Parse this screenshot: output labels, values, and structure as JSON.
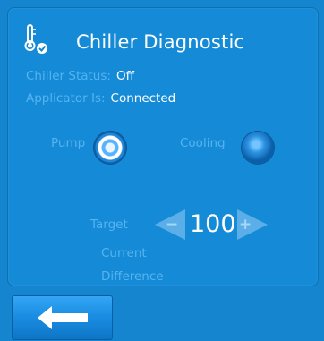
{
  "header": {
    "title": "Chiller Diagnostic",
    "icon": "thermometer-check-icon"
  },
  "status": {
    "chiller_label": "Chiller Status:",
    "chiller_value": "Off",
    "applicator_label": "Applicator Is:",
    "applicator_value": "Connected"
  },
  "controls": {
    "pump_label": "Pump",
    "cooling_label": "Cooling"
  },
  "target": {
    "label": "Target",
    "value": "100",
    "minus_symbol": "−",
    "plus_symbol": "+"
  },
  "readouts": {
    "current_label": "Current",
    "difference_label": "Difference"
  },
  "footer": {
    "back_icon": "left-arrow-icon"
  },
  "colors": {
    "background": "#1585cf",
    "panel": "#158bd8",
    "label": "#55b3f0",
    "value": "#ffffff"
  }
}
